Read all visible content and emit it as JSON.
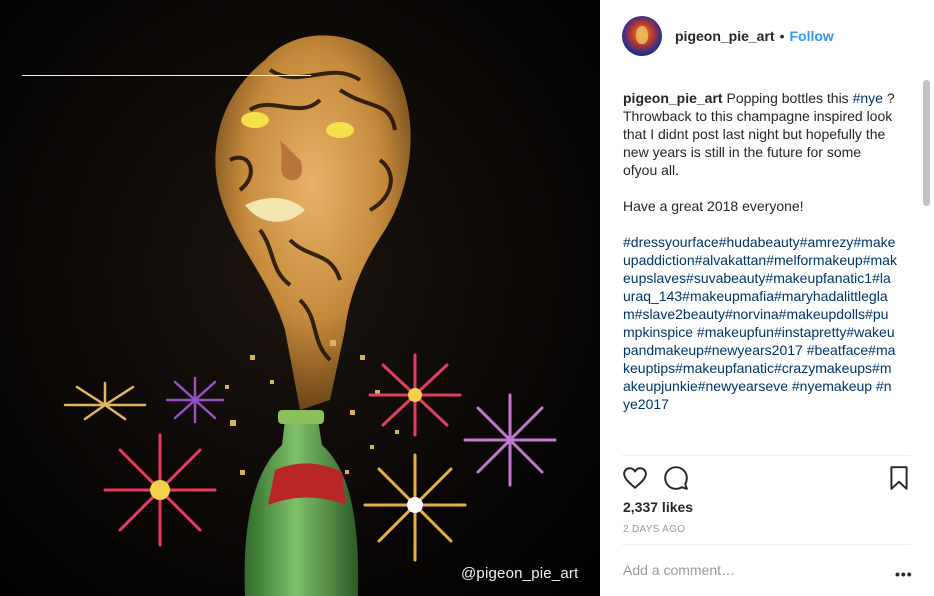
{
  "post": {
    "watermark": "@pigeon_pie_art"
  },
  "header": {
    "username": "pigeon_pie_art",
    "dot": "•",
    "follow_label": "Follow"
  },
  "caption": {
    "username": "pigeon_pie_art",
    "text_before_tag": " Popping bottles this ",
    "inline_tag": "#nye",
    "text_after_tag": " ?",
    "body": "Throwback to this champagne inspired look that I didnt post last night but hopefully the new years is still in the future for some ofyou all.",
    "wish": "Have a great 2018 everyone!",
    "hashtags": "#dressyourface#hudabeauty#amrezy#makeupaddiction#alvakattan#melformakeup#makeupslaves#suvabeauty#makeupfanatic1#lauraq_143#makeupmafia#maryhadalittleglam#slave2beauty#norvina#makeupdolls#pumpkinspice #makeupfun#instapretty#wakeupandmakeup#newyears2017 #beatface#makeuptips#makeupfanatic#crazymakeups#makeupjunkie#newyearseve #nyemakeup #nye2017"
  },
  "actions": {
    "like_icon": "heart-icon",
    "comment_icon": "comment-icon",
    "save_icon": "bookmark-icon",
    "likes": "2,337 likes",
    "time_ago": "2 DAYS AGO"
  },
  "comment_box": {
    "placeholder": "Add a comment…",
    "more_label": "•••"
  }
}
